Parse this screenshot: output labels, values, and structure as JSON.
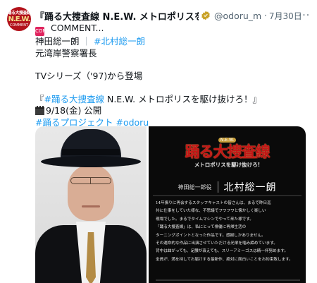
{
  "account": {
    "avatar_lines": [
      "踊る大捜査線",
      "N.E.W.",
      "COMMENT"
    ],
    "display_name": "『踊る大捜査線 N.E.W. メトロポリスを駆け抜けろ！』",
    "handle": "@odoru_movie",
    "separator": "·",
    "date": "7月30日",
    "more_label": "···"
  },
  "tweet": {
    "line1_emoji": "COMMENT",
    "line1_text": " COMMENT...",
    "line2_name": "神田総一朗",
    "line2_sep": "｜",
    "line2_tag": "#北村総一朗",
    "line3": "元湾岸警察署長",
    "line4": "TVシリーズ（'97)から登場",
    "line5_open": "『",
    "line5_tag": "#踊る大捜査線",
    "line5_rest": " N.E.W. メトロポリスを駆け抜けろ！』",
    "line6": "9/18(金) 公開",
    "hashtags": [
      "#踊るプロジェクト",
      "#odoru"
    ]
  },
  "poster": {
    "badge": "N.E.W.",
    "title": "踊る大捜査線",
    "subtitle": "メトロポリスを駆け抜けろ!",
    "role": "神田総一郎役",
    "actor": "北村総一朗",
    "body_lines": [
      "14年振りに再会するスタッフキャストの皆さんは、まるで昨日迄",
      "共に仕事をしていた様な、不思議でフワフワと懐かしく楽しい",
      "現場でした。まるでタイムマシンでやって来た様です。",
      "「踊る大捜査線」は、私にとって俳優に再帰生活の",
      "ターニングポイントとなった作品です。感謝しかありません。",
      "その運命的な作品に出演させていただける光栄を噛み締めています。",
      "背中は曲がっても、足腰が衰えても、スリーアミーゴスは精一杯努めます。",
      "全員が、満を持してお届けする最新作、絶対に面白いことをお約束致します。"
    ]
  }
}
